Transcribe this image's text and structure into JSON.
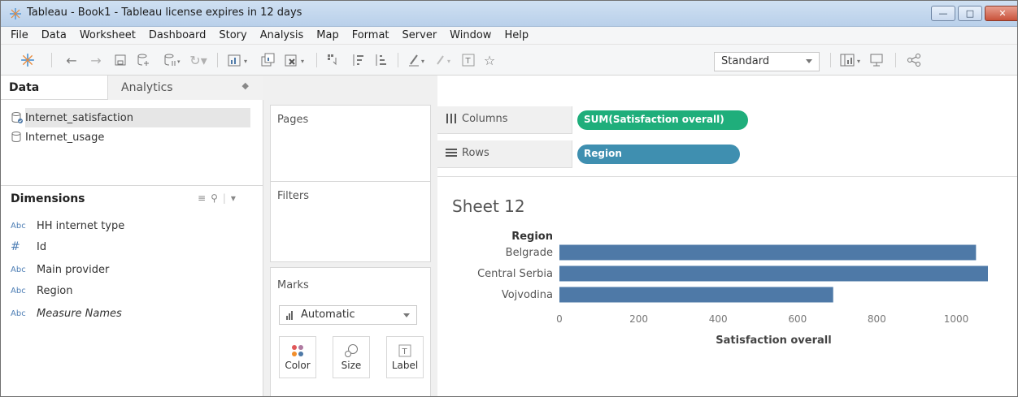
{
  "window": {
    "title": "Tableau - Book1 - Tableau license expires in 12 days"
  },
  "menu": [
    "File",
    "Data",
    "Worksheet",
    "Dashboard",
    "Story",
    "Analysis",
    "Map",
    "Format",
    "Server",
    "Window",
    "Help"
  ],
  "toolbar": {
    "fit_select": "Standard",
    "icons": [
      "tableau-logo-icon",
      "back-icon",
      "forward-icon",
      "save-icon",
      "add-datasource-icon",
      "pause-updates-icon",
      "refresh-icon",
      "new-worksheet-icon",
      "duplicate-icon",
      "clear-icon",
      "swap-icon",
      "sort-ascending-icon",
      "sort-descending-icon",
      "highlight-icon",
      "group-icon",
      "label-icon",
      "pin-icon",
      "show-cards-icon",
      "presentation-icon",
      "share-icon"
    ]
  },
  "data_pane": {
    "tab_data": "Data",
    "tab_analytics": "Analytics",
    "datasources": [
      "Internet_satisfaction",
      "Internet_usage"
    ],
    "dimensions_heading": "Dimensions",
    "fields": [
      {
        "type": "Abc",
        "label": "HH internet type"
      },
      {
        "type": "#",
        "label": "Id"
      },
      {
        "type": "Abc",
        "label": "Main provider"
      },
      {
        "type": "Abc",
        "label": "Region"
      },
      {
        "type": "Abc",
        "label": "Measure Names"
      }
    ]
  },
  "shelves": {
    "pages": "Pages",
    "filters": "Filters",
    "marks": "Marks",
    "mark_type": "Automatic",
    "mark_buttons": [
      "Color",
      "Size",
      "Label"
    ],
    "columns_label": "Columns",
    "rows_label": "Rows",
    "columns_pill": "SUM(Satisfaction overall)",
    "rows_pill": "Region"
  },
  "sheet": {
    "title": "Sheet 12"
  },
  "chart_data": {
    "type": "bar",
    "orientation": "horizontal",
    "row_header": "Region",
    "categories": [
      "Belgrade",
      "Central Serbia",
      "Vojvodina"
    ],
    "values": [
      1050,
      1080,
      690
    ],
    "xlabel": "Satisfaction overall",
    "xticks": [
      0,
      200,
      400,
      600,
      800,
      1000
    ],
    "xlim": [
      0,
      1080
    ],
    "bar_color": "#4e79a7",
    "grid": false
  }
}
